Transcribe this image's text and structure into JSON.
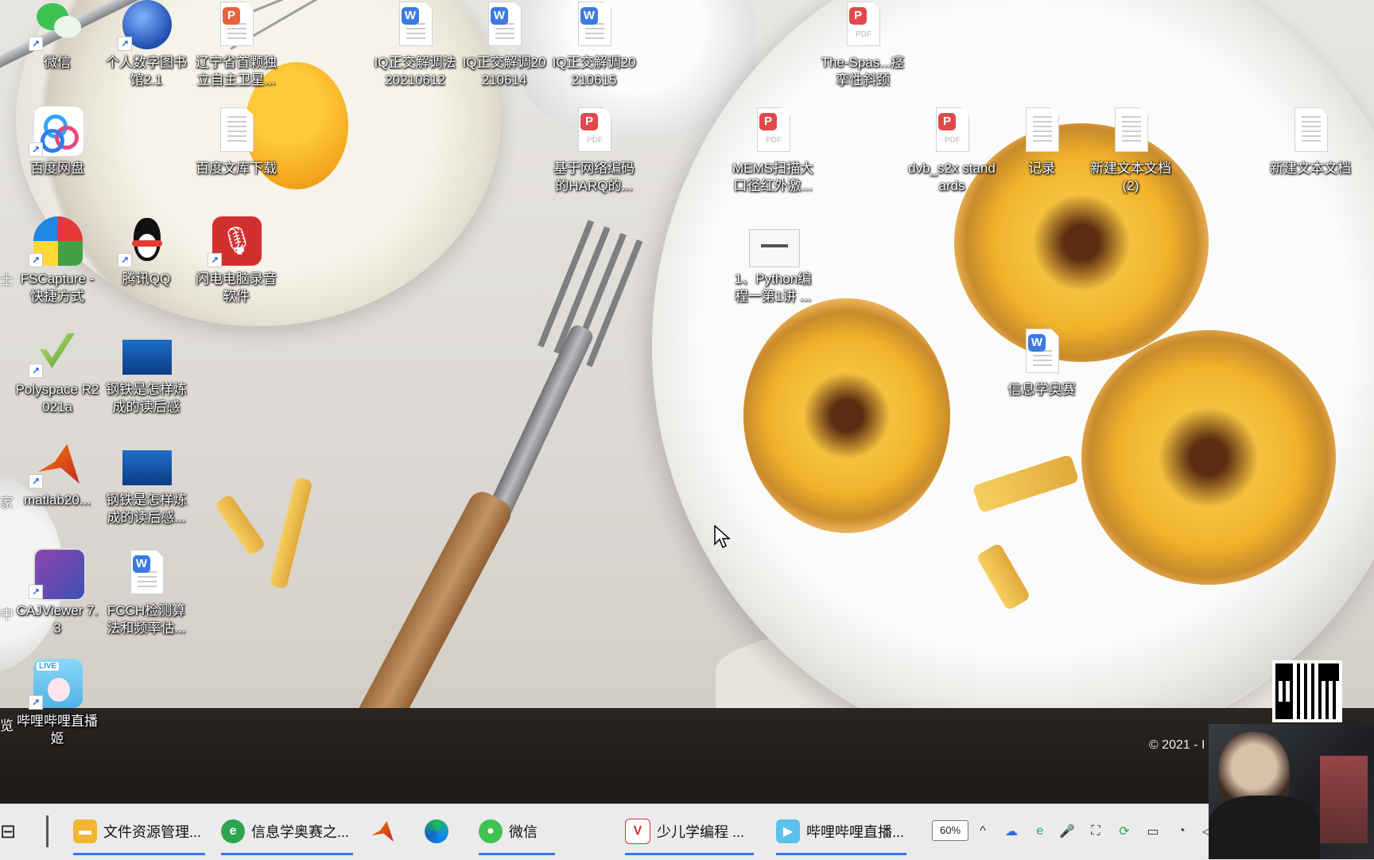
{
  "desktop": {
    "icons": [
      {
        "label": "微信",
        "type": "app-wechat"
      },
      {
        "label": "个人数字图书馆2.1",
        "type": "app-library"
      },
      {
        "label": "辽宁省首颗独立自主卫星...",
        "type": "ppt"
      },
      {
        "label": "IQ正交解调法20210612",
        "type": "word"
      },
      {
        "label": "IQ正交解调20210614",
        "type": "word"
      },
      {
        "label": "IQ正交解调20210615",
        "type": "word"
      },
      {
        "label": "The-Spas...痉挛性斜颈",
        "type": "pdf"
      },
      {
        "label": "百度网盘",
        "type": "app-baidu"
      },
      {
        "label": "百度文库下载",
        "type": "text"
      },
      {
        "label": "基于网络编码的HARQ的...",
        "type": "pdf"
      },
      {
        "label": "MEMS扫描大口径红外激...",
        "type": "pdf"
      },
      {
        "label": "dvb_s2x standards",
        "type": "pdf"
      },
      {
        "label": "记录",
        "type": "text"
      },
      {
        "label": "新建文本文档 (2)",
        "type": "text"
      },
      {
        "label": "新建文本文档",
        "type": "text"
      },
      {
        "label": "FSCapture - 快捷方式",
        "type": "app-fscapture"
      },
      {
        "label": "腾讯QQ",
        "type": "app-qq"
      },
      {
        "label": "闪电电脑录音软件",
        "type": "app-recorder"
      },
      {
        "label": "1、Python编程一第1讲 ...",
        "type": "slide"
      },
      {
        "label": "信息学奥赛",
        "type": "word"
      },
      {
        "label": "Polyspace R2021a",
        "type": "app-polyspace"
      },
      {
        "label": "钢铁是怎样炼成的读后感",
        "type": "slide-blue"
      },
      {
        "label": "matlab20...",
        "type": "app-matlab"
      },
      {
        "label": "钢铁是怎样炼成的读后感...",
        "type": "slide-blue"
      },
      {
        "label": "CAJViewer 7.3",
        "type": "app-caj"
      },
      {
        "label": "FCCH检测算法和频率估...",
        "type": "word"
      },
      {
        "label": "哔哩哔哩直播姬",
        "type": "app-bilibili"
      }
    ],
    "edge_labels": [
      "士",
      "家",
      "中",
      "览"
    ],
    "copyright": "© 2021 - I"
  },
  "taskbar": {
    "apps": [
      {
        "label": "文件资源管理...",
        "icon": "folder-icon"
      },
      {
        "label": "信息学奥赛之...",
        "icon": "ie-icon"
      },
      {
        "label": "",
        "icon": "matlab-icon"
      },
      {
        "label": "",
        "icon": "edge-icon"
      },
      {
        "label": "微信",
        "icon": "wechat-icon"
      },
      {
        "label": "少儿学编程 ...",
        "icon": "video-icon"
      },
      {
        "label": "哔哩哔哩直播...",
        "icon": "bilibili-icon"
      }
    ],
    "tray": {
      "battery_percent": "60%",
      "chevron": "^"
    }
  },
  "colors": {
    "word_blue": "#3b7be0",
    "pdf_red": "#e0494b",
    "ppt_orange": "#e5623a",
    "taskbar_bg": "#ebebee",
    "accent": "#2d7be5"
  }
}
